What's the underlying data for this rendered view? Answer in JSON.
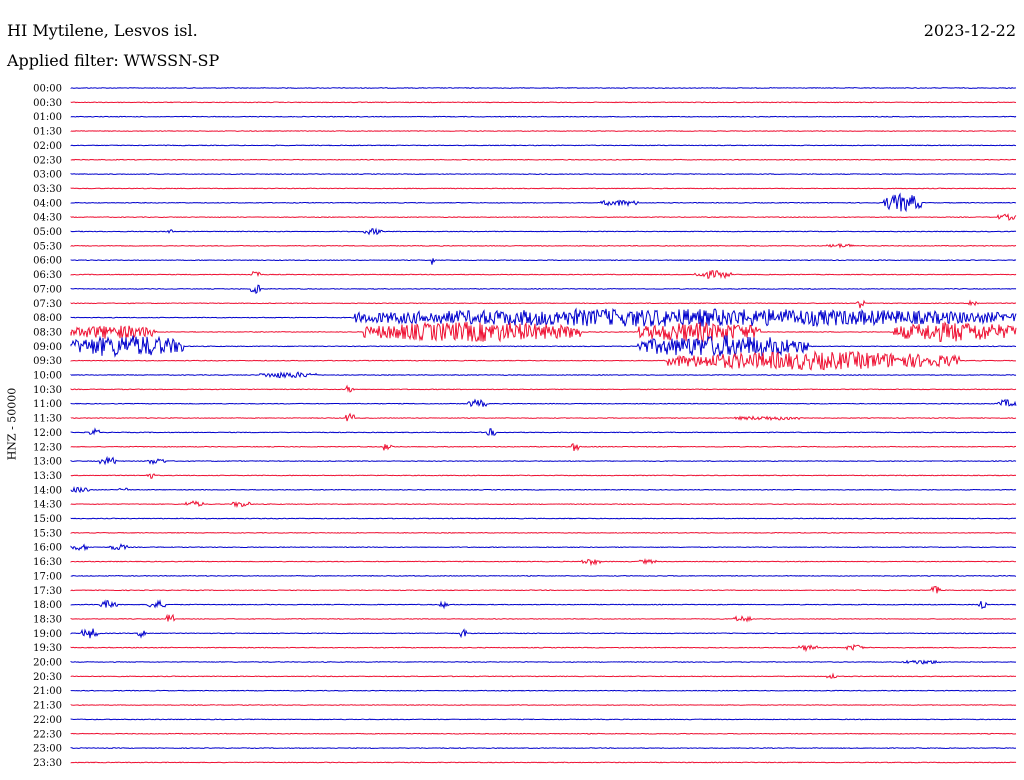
{
  "header": {
    "station": "HI Mytilene, Lesvos isl.",
    "date": "2023-12-22",
    "filter_label": "Applied filter:",
    "filter_value": "WWSSN-SP"
  },
  "colors": {
    "trace_a": "#0000cc",
    "trace_b": "#ee1133"
  },
  "chart_data": {
    "type": "line",
    "channel_label": "HNZ - 50000",
    "rows": [
      {
        "label": "00:00",
        "events": []
      },
      {
        "label": "00:30",
        "events": []
      },
      {
        "label": "01:00",
        "events": []
      },
      {
        "label": "01:30",
        "events": []
      },
      {
        "label": "02:00",
        "events": []
      },
      {
        "label": "02:30",
        "events": []
      },
      {
        "label": "03:00",
        "events": []
      },
      {
        "label": "03:30",
        "events": []
      },
      {
        "label": "04:00",
        "events": [
          {
            "s": 0.56,
            "e": 0.6,
            "a": 3
          },
          {
            "s": 0.86,
            "e": 0.9,
            "a": 9
          }
        ]
      },
      {
        "label": "04:30",
        "events": [
          {
            "s": 0.98,
            "e": 1.0,
            "a": 3
          }
        ]
      },
      {
        "label": "05:00",
        "events": [
          {
            "s": 0.1,
            "e": 0.11,
            "a": 2
          },
          {
            "s": 0.31,
            "e": 0.33,
            "a": 3
          }
        ]
      },
      {
        "label": "05:30",
        "events": [
          {
            "s": 0.8,
            "e": 0.83,
            "a": 2
          }
        ]
      },
      {
        "label": "06:00",
        "events": [
          {
            "s": 0.38,
            "e": 0.385,
            "a": 5
          }
        ]
      },
      {
        "label": "06:30",
        "events": [
          {
            "s": 0.19,
            "e": 0.2,
            "a": 5
          },
          {
            "s": 0.66,
            "e": 0.7,
            "a": 4
          }
        ]
      },
      {
        "label": "07:00",
        "events": [
          {
            "s": 0.19,
            "e": 0.2,
            "a": 6
          }
        ]
      },
      {
        "label": "07:30",
        "events": [
          {
            "s": 0.83,
            "e": 0.84,
            "a": 5
          },
          {
            "s": 0.95,
            "e": 0.96,
            "a": 4
          }
        ]
      },
      {
        "label": "08:00",
        "events": [
          {
            "s": 0.3,
            "e": 1.0,
            "a": 9
          }
        ]
      },
      {
        "label": "08:30",
        "events": [
          {
            "s": 0.0,
            "e": 0.09,
            "a": 7
          },
          {
            "s": 0.31,
            "e": 0.54,
            "a": 10
          },
          {
            "s": 0.6,
            "e": 0.73,
            "a": 10
          },
          {
            "s": 0.87,
            "e": 1.0,
            "a": 10
          }
        ]
      },
      {
        "label": "09:00",
        "events": [
          {
            "s": 0.0,
            "e": 0.12,
            "a": 11
          },
          {
            "s": 0.6,
            "e": 0.78,
            "a": 11
          }
        ]
      },
      {
        "label": "09:30",
        "events": [
          {
            "s": 0.63,
            "e": 0.94,
            "a": 9
          }
        ]
      },
      {
        "label": "10:00",
        "events": [
          {
            "s": 0.2,
            "e": 0.26,
            "a": 3
          }
        ]
      },
      {
        "label": "10:30",
        "events": [
          {
            "s": 0.29,
            "e": 0.3,
            "a": 4
          }
        ]
      },
      {
        "label": "11:00",
        "events": [
          {
            "s": 0.42,
            "e": 0.44,
            "a": 4
          },
          {
            "s": 0.98,
            "e": 1.0,
            "a": 4
          }
        ]
      },
      {
        "label": "11:30",
        "events": [
          {
            "s": 0.29,
            "e": 0.3,
            "a": 5
          },
          {
            "s": 0.7,
            "e": 0.78,
            "a": 2
          }
        ]
      },
      {
        "label": "12:00",
        "events": [
          {
            "s": 0.02,
            "e": 0.03,
            "a": 4
          },
          {
            "s": 0.44,
            "e": 0.45,
            "a": 4
          }
        ]
      },
      {
        "label": "12:30",
        "events": [
          {
            "s": 0.33,
            "e": 0.34,
            "a": 5
          },
          {
            "s": 0.53,
            "e": 0.54,
            "a": 5
          }
        ]
      },
      {
        "label": "13:00",
        "events": [
          {
            "s": 0.03,
            "e": 0.05,
            "a": 4
          },
          {
            "s": 0.08,
            "e": 0.1,
            "a": 3
          }
        ]
      },
      {
        "label": "13:30",
        "events": [
          {
            "s": 0.08,
            "e": 0.09,
            "a": 3
          }
        ]
      },
      {
        "label": "14:00",
        "events": [
          {
            "s": 0.0,
            "e": 0.02,
            "a": 3
          },
          {
            "s": 0.05,
            "e": 0.06,
            "a": 3
          }
        ]
      },
      {
        "label": "14:30",
        "events": [
          {
            "s": 0.12,
            "e": 0.14,
            "a": 3
          },
          {
            "s": 0.17,
            "e": 0.19,
            "a": 3
          }
        ]
      },
      {
        "label": "15:00",
        "events": []
      },
      {
        "label": "15:30",
        "events": []
      },
      {
        "label": "16:00",
        "events": [
          {
            "s": 0.0,
            "e": 0.02,
            "a": 3
          },
          {
            "s": 0.04,
            "e": 0.06,
            "a": 3
          }
        ]
      },
      {
        "label": "16:30",
        "events": [
          {
            "s": 0.54,
            "e": 0.56,
            "a": 3
          },
          {
            "s": 0.6,
            "e": 0.62,
            "a": 2
          }
        ]
      },
      {
        "label": "17:00",
        "events": []
      },
      {
        "label": "17:30",
        "events": [
          {
            "s": 0.91,
            "e": 0.92,
            "a": 4
          }
        ]
      },
      {
        "label": "18:00",
        "events": [
          {
            "s": 0.03,
            "e": 0.05,
            "a": 4
          },
          {
            "s": 0.08,
            "e": 0.1,
            "a": 4
          },
          {
            "s": 0.39,
            "e": 0.4,
            "a": 3
          },
          {
            "s": 0.96,
            "e": 0.97,
            "a": 5
          }
        ]
      },
      {
        "label": "18:30",
        "events": [
          {
            "s": 0.1,
            "e": 0.11,
            "a": 5
          },
          {
            "s": 0.7,
            "e": 0.72,
            "a": 3
          }
        ]
      },
      {
        "label": "19:00",
        "events": [
          {
            "s": 0.01,
            "e": 0.03,
            "a": 5
          },
          {
            "s": 0.07,
            "e": 0.08,
            "a": 4
          },
          {
            "s": 0.41,
            "e": 0.42,
            "a": 4
          }
        ]
      },
      {
        "label": "19:30",
        "events": [
          {
            "s": 0.77,
            "e": 0.79,
            "a": 3
          },
          {
            "s": 0.82,
            "e": 0.84,
            "a": 3
          }
        ]
      },
      {
        "label": "20:00",
        "events": [
          {
            "s": 0.88,
            "e": 0.92,
            "a": 2
          }
        ]
      },
      {
        "label": "20:30",
        "events": [
          {
            "s": 0.8,
            "e": 0.81,
            "a": 3
          }
        ]
      },
      {
        "label": "21:00",
        "events": []
      },
      {
        "label": "21:30",
        "events": []
      },
      {
        "label": "22:00",
        "events": []
      },
      {
        "label": "22:30",
        "events": []
      },
      {
        "label": "23:00",
        "events": []
      },
      {
        "label": "23:30",
        "events": []
      }
    ]
  }
}
